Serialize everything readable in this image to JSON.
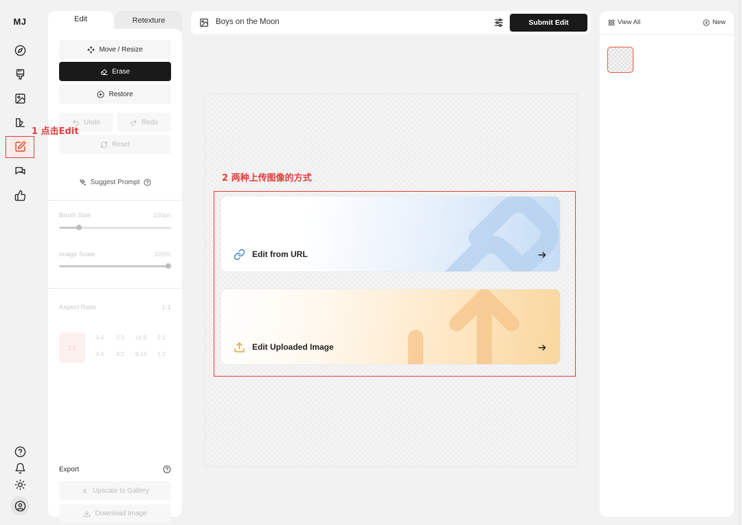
{
  "app": {
    "logo": "MJ"
  },
  "rail": {
    "items": [
      {
        "name": "explore",
        "icon": "compass-icon"
      },
      {
        "name": "create",
        "icon": "paintbrush-icon"
      },
      {
        "name": "images",
        "icon": "image-icon"
      },
      {
        "name": "organize",
        "icon": "shapes-icon"
      },
      {
        "name": "edit",
        "icon": "edit-icon",
        "active": true
      },
      {
        "name": "chat",
        "icon": "chat-icon"
      },
      {
        "name": "rate",
        "icon": "thumbs-up-icon"
      }
    ],
    "bottom": [
      {
        "name": "help",
        "icon": "help-icon"
      },
      {
        "name": "notifications",
        "icon": "bell-icon"
      },
      {
        "name": "theme",
        "icon": "sun-icon"
      },
      {
        "name": "account",
        "icon": "user-icon"
      }
    ]
  },
  "panel": {
    "tabs": [
      {
        "label": "Edit",
        "active": true
      },
      {
        "label": "Retexture",
        "active": false
      }
    ],
    "tools": {
      "move_resize": "Move / Resize",
      "erase": "Erase",
      "restore": "Restore",
      "undo": "Undo",
      "redo": "Redo",
      "reset": "Reset"
    },
    "suggest_prompt": "Suggest Prompt",
    "brush_size": {
      "label": "Brush Size",
      "value": "100px",
      "level": 0.18
    },
    "image_scale": {
      "label": "Image Scale",
      "value": "100%",
      "level": 1.0
    },
    "aspect_ratio": {
      "label": "Aspect Ratio",
      "value": "1:1",
      "selected": "1:1",
      "options": [
        "3:4",
        "2:3",
        "16:9",
        "2:1",
        "4:3",
        "3:2",
        "9:16",
        "1:2"
      ]
    },
    "export": {
      "label": "Export",
      "upscale": "Upscale to Gallery",
      "download": "Download Image"
    }
  },
  "topbar": {
    "title": "Boys on the Moon",
    "submit": "Submit Edit"
  },
  "cards": {
    "url": {
      "label": "Edit from URL"
    },
    "upload": {
      "label": "Edit Uploaded Image"
    }
  },
  "annotations": {
    "step1": "1 点击Edit",
    "step2": "2 两种上传图像的方式",
    "color": "#e23b3b"
  },
  "right_panel": {
    "view_all": "View All",
    "new": "New"
  },
  "colors": {
    "accent": "#d94a2b",
    "primary_button": "#1a1a1a",
    "url_card": "#c4dcf5",
    "upload_card": "#f9d69d"
  }
}
